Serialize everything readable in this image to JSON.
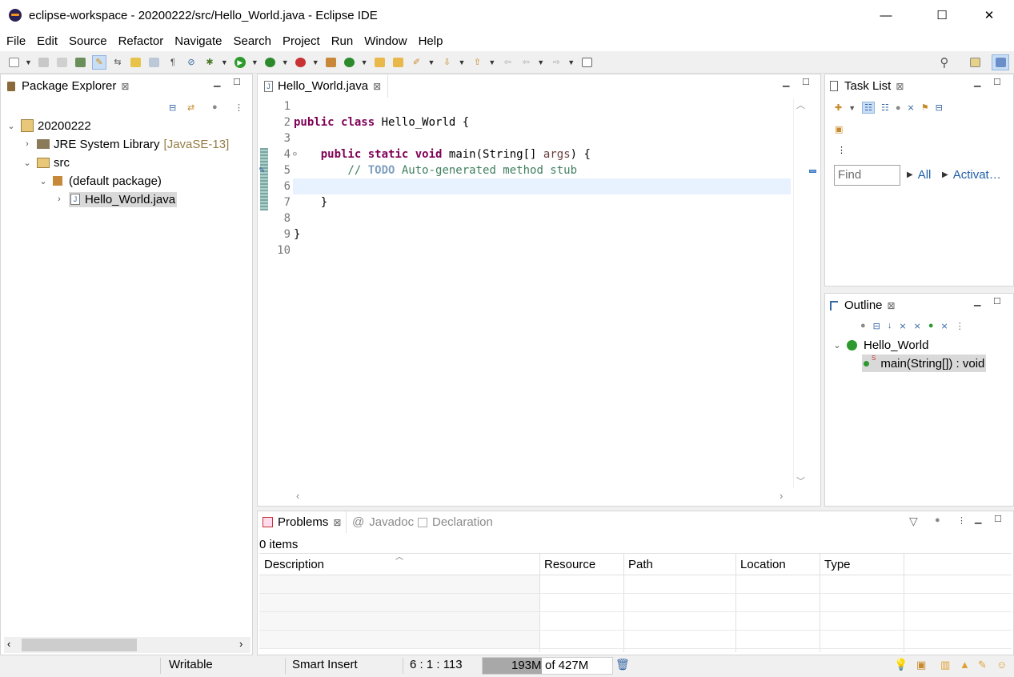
{
  "window": {
    "title": "eclipse-workspace - 20200222/src/Hello_World.java - Eclipse IDE",
    "minimize": "—",
    "maximize": "☐",
    "close": "✕"
  },
  "menu": [
    "File",
    "Edit",
    "Source",
    "Refactor",
    "Navigate",
    "Search",
    "Project",
    "Run",
    "Window",
    "Help"
  ],
  "package_explorer": {
    "title": "Package Explorer",
    "tree": {
      "project": "20200222",
      "jre": "JRE System Library",
      "jre_tag": "[JavaSE-13]",
      "src": "src",
      "pkg": "(default package)",
      "file": "Hello_World.java"
    }
  },
  "editor": {
    "tab": "Hello_World.java",
    "line_numbers": [
      "1",
      "2",
      "3",
      "4",
      "5",
      "6",
      "7",
      "8",
      "9",
      "10"
    ],
    "code": {
      "l2": {
        "k1": "public",
        "k2": "class",
        "rest": " Hello_World {"
      },
      "l4": {
        "k1": "public",
        "k2": "static",
        "k3": "void",
        "rest1": " main(String[] ",
        "arg": "args",
        "rest2": ") {"
      },
      "l5": {
        "pre": "        // ",
        "todo": "TODO",
        "rest": " Auto-generated method stub"
      },
      "l7": "    }",
      "l9": "}"
    }
  },
  "task_list": {
    "title": "Task List",
    "find_placeholder": "Find",
    "all": "All",
    "activate": "Activat…"
  },
  "outline": {
    "title": "Outline",
    "class": "Hello_World",
    "method": "main(String[]) : void"
  },
  "problems": {
    "tabs": {
      "problems": "Problems",
      "javadoc": "Javadoc",
      "declaration": "Declaration"
    },
    "count": "0 items",
    "columns": [
      "Description",
      "Resource",
      "Path",
      "Location",
      "Type"
    ]
  },
  "status": {
    "writable": "Writable",
    "insert_mode": "Smart Insert",
    "position": "6 : 1 : 113",
    "heap_used": "193M",
    "heap_total": "of 427M"
  },
  "colors": {
    "keyword": "#7f0055",
    "comment": "#3f7f5f",
    "todo": "#7f9fbf",
    "selection": "#e8f2fe"
  }
}
